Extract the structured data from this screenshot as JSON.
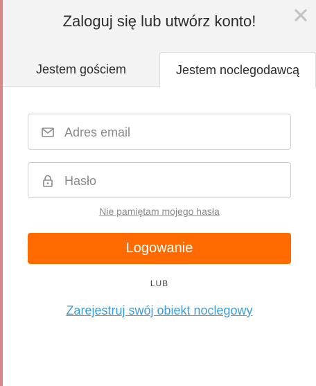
{
  "modal": {
    "title": "Zaloguj się lub utwórz konto!",
    "close_icon": "close-icon"
  },
  "tabs": [
    {
      "label": "Jestem gościem",
      "active": false
    },
    {
      "label": "Jestem noclegodawcą",
      "active": true
    }
  ],
  "form": {
    "email": {
      "placeholder": "Adres email",
      "value": "",
      "icon": "envelope-icon"
    },
    "password": {
      "placeholder": "Hasło",
      "value": "",
      "icon": "lock-icon"
    },
    "forgot_link": "Nie pamiętam mojego hasła",
    "login_button": "Logowanie",
    "or_divider": "LUB",
    "register_link": "Zarejestruj swój obiekt noclegowy"
  },
  "colors": {
    "accent": "#ff6b00",
    "link": "#3d9bd8",
    "header_bg": "#f3f3f3"
  }
}
